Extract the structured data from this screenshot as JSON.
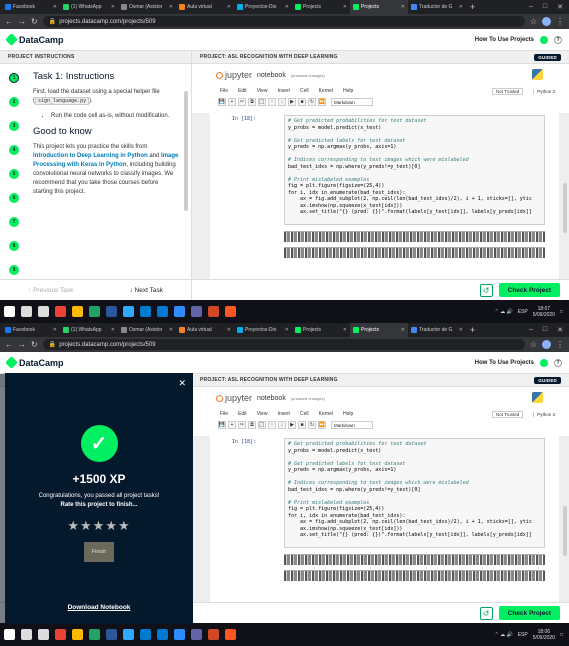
{
  "browser": {
    "tabs": [
      {
        "label": "Facebook",
        "color": "#1877f2"
      },
      {
        "label": "(1) WhatsApp",
        "color": "#25d366"
      },
      {
        "label": "Osmar (Asistor",
        "color": "#888888"
      },
      {
        "label": "Aula virtual",
        "color": "#f58220"
      },
      {
        "label": "Proyectos-Dio",
        "color": "#00b0f0"
      },
      {
        "label": "Projects",
        "color": "#03ef62"
      },
      {
        "label": "Projects",
        "color": "#03ef62"
      },
      {
        "label": "Traductor de G",
        "color": "#4285f4"
      }
    ],
    "active_tab_index": 6,
    "url_top": "projects.datacamp.com/projects/509",
    "url_bottom": "projects.datacamp.com/projects/509",
    "window_controls": [
      "–",
      "□",
      "✕"
    ]
  },
  "datacamp": {
    "logo": "DataCamp",
    "how_to": "How To Use Projects",
    "instructions_header": "PROJECT INSTRUCTIONS",
    "project_header": "PROJECT: ASL RECOGNITION WITH DEEP LEARNING",
    "guided": "GUIDED",
    "steps": [
      "1",
      "2",
      "3",
      "4",
      "5",
      "6",
      "7",
      "8",
      "9"
    ],
    "task_title": "Task 1: Instructions",
    "para1_a": "First, load the dataset using a special helper file (",
    "para1_code": "sign_language.py",
    "para1_b": ").",
    "bullet": "Run the code cell as-is, without modification.",
    "good_title": "Good to know",
    "para2_a": "This project lets you practice the skills from ",
    "link1": "Introduction to Deep Learning in Python",
    "para2_b": " and ",
    "link2": "Image Processing with Keras in Python",
    "para2_c": ", including building convolutional neural networks to classify images. We recommend that you take those courses before starting this project.",
    "prev_task": "Previous Task",
    "next_task": "Next Task",
    "check_project": "Check Project"
  },
  "jupyter": {
    "logo": "jupyter",
    "notebook": "notebook",
    "unsaved": "(unsaved changes)",
    "menus": [
      "File",
      "Edit",
      "View",
      "Insert",
      "Cell",
      "Kernel",
      "Help"
    ],
    "not_trusted": "Not Trusted",
    "kernel": "Python 3",
    "celltype": "Markdown",
    "toolbar_icons": [
      "💾",
      "+",
      "✂",
      "⧉",
      "📋",
      "↑",
      "↓",
      "▶",
      "■",
      "↻",
      "⏩"
    ],
    "prompt": "In [18]:",
    "code": [
      {
        "t": "# Get predicted probabilities for test dataset",
        "c": true
      },
      {
        "t": "y_probs = model.predict(x_test)",
        "c": false
      },
      {
        "t": "",
        "c": false
      },
      {
        "t": "# Get predicted labels for test dataset",
        "c": true
      },
      {
        "t": "y_preds = np.argmax(y_probs, axis=1)",
        "c": false
      },
      {
        "t": "",
        "c": false
      },
      {
        "t": "# Indices corresponding to test images which were mislabeled",
        "c": true
      },
      {
        "t": "bad_test_idxs = np.where(y_preds!=y_test)[0]",
        "c": false
      },
      {
        "t": "",
        "c": false
      },
      {
        "t": "# Print mislabeled examples",
        "c": true
      },
      {
        "t": "fig = plt.figure(figsize=(25,4))",
        "c": false
      },
      {
        "t": "for i, idx in enumerate(bad_test_idxs):",
        "c": false
      },
      {
        "t": "    ax = fig.add_subplot(2, np.ceil(len(bad_test_idxs)/2), i + 1, xticks=[], ytic",
        "c": false
      },
      {
        "t": "    ax.imshow(np.squeeze(x_test[idx]))",
        "c": false
      },
      {
        "t": "    ax.set_title(\"{} (pred: {})\".format(labels[y_test[idx]], labels[y_preds[idx]]",
        "c": false
      }
    ]
  },
  "modal": {
    "xp": "+1500 XP",
    "line1": "Congratulations, you passed all project tasks!",
    "line2": "Rate this project to finish...",
    "stars": "★★★★★",
    "finish": "Finish",
    "download": "Download Notebook"
  },
  "taskbar": {
    "top_time": "18:07",
    "top_date": "5/09/2020",
    "bottom_time": "18:06",
    "bottom_date": "5/09/2020",
    "lang": "ESP",
    "icons": [
      {
        "name": "windows-icon",
        "color": "#ffffff"
      },
      {
        "name": "search-icon",
        "color": "#dddddd"
      },
      {
        "name": "task-view-icon",
        "color": "#dddddd"
      },
      {
        "name": "chrome-icon",
        "color": "#ea4335"
      },
      {
        "name": "explorer-icon",
        "color": "#ffb900"
      },
      {
        "name": "green-app-icon",
        "color": "#21a366"
      },
      {
        "name": "word-icon",
        "color": "#2b579a"
      },
      {
        "name": "photoshop-icon",
        "color": "#31a8ff"
      },
      {
        "name": "vscode-icon",
        "color": "#007acc"
      },
      {
        "name": "app-icon",
        "color": "#0078d4"
      },
      {
        "name": "zoom-icon",
        "color": "#2d8cff"
      },
      {
        "name": "teams-icon",
        "color": "#6264a7"
      },
      {
        "name": "powerpoint-icon",
        "color": "#d24726"
      },
      {
        "name": "app-icon",
        "color": "#ff5722"
      }
    ]
  }
}
